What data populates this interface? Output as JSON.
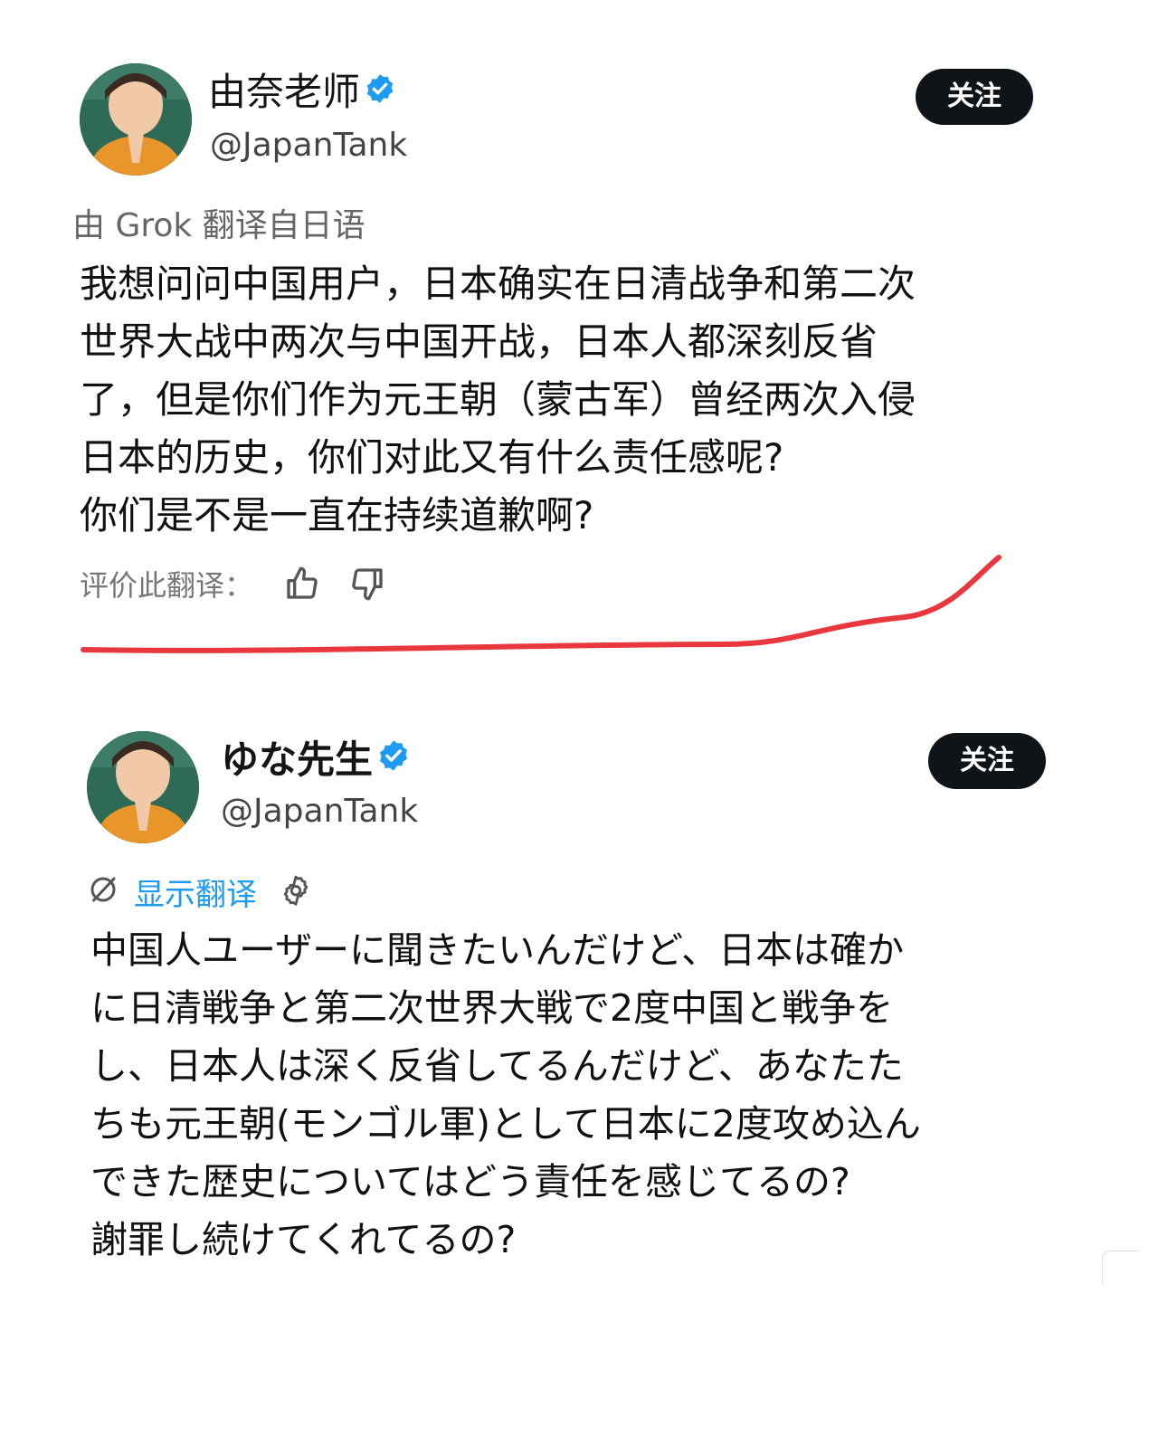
{
  "posts": [
    {
      "display_name": "由奈老师",
      "handle": "@JapanTank",
      "follow_label": "关注",
      "translated_note": "由 Grok 翻译自日语",
      "body_lines": [
        "我想问问中国用户，日本确实在日清战争和第二次",
        "世界大战中两次与中国开战，日本人都深刻反省",
        "了，但是你们作为元王朝（蒙古军）曾经两次入侵",
        "日本的历史，你们对此又有什么责任感呢?",
        "你们是不是一直在持续道歉啊?"
      ],
      "rate_label": "评价此翻译：",
      "verified_icon": "verified-badge-icon",
      "rate_icons": [
        "thumbs-up-icon",
        "thumbs-down-icon"
      ]
    },
    {
      "display_name": "ゆな先生",
      "handle": "@JapanTank",
      "follow_label": "关注",
      "show_translation_label": "显示翻译",
      "body_lines": [
        "中国人ユーザーに聞きたいんだけど、日本は確か",
        "に日清戦争と第二次世界大戦で2度中国と戦争を",
        "し、日本人は深く反省してるんだけど、あなたた",
        "ちも元王朝(モンゴル軍)として日本に2度攻め込ん",
        "できた歴史についてはどう責任を感じてるの?",
        "謝罪し続けてくれてるの?"
      ],
      "verified_icon": "verified-badge-icon",
      "translate_icon": "translate-icon",
      "settings_icon": "gear-icon"
    }
  ],
  "colors": {
    "follow_button_bg": "#0f1419",
    "verified_blue": "#1d9bf0",
    "link_blue": "#1d9bf0",
    "annotation_red": "#e8383d",
    "avatar_sweater": "#e8952a",
    "avatar_background": "#2f6a57"
  }
}
